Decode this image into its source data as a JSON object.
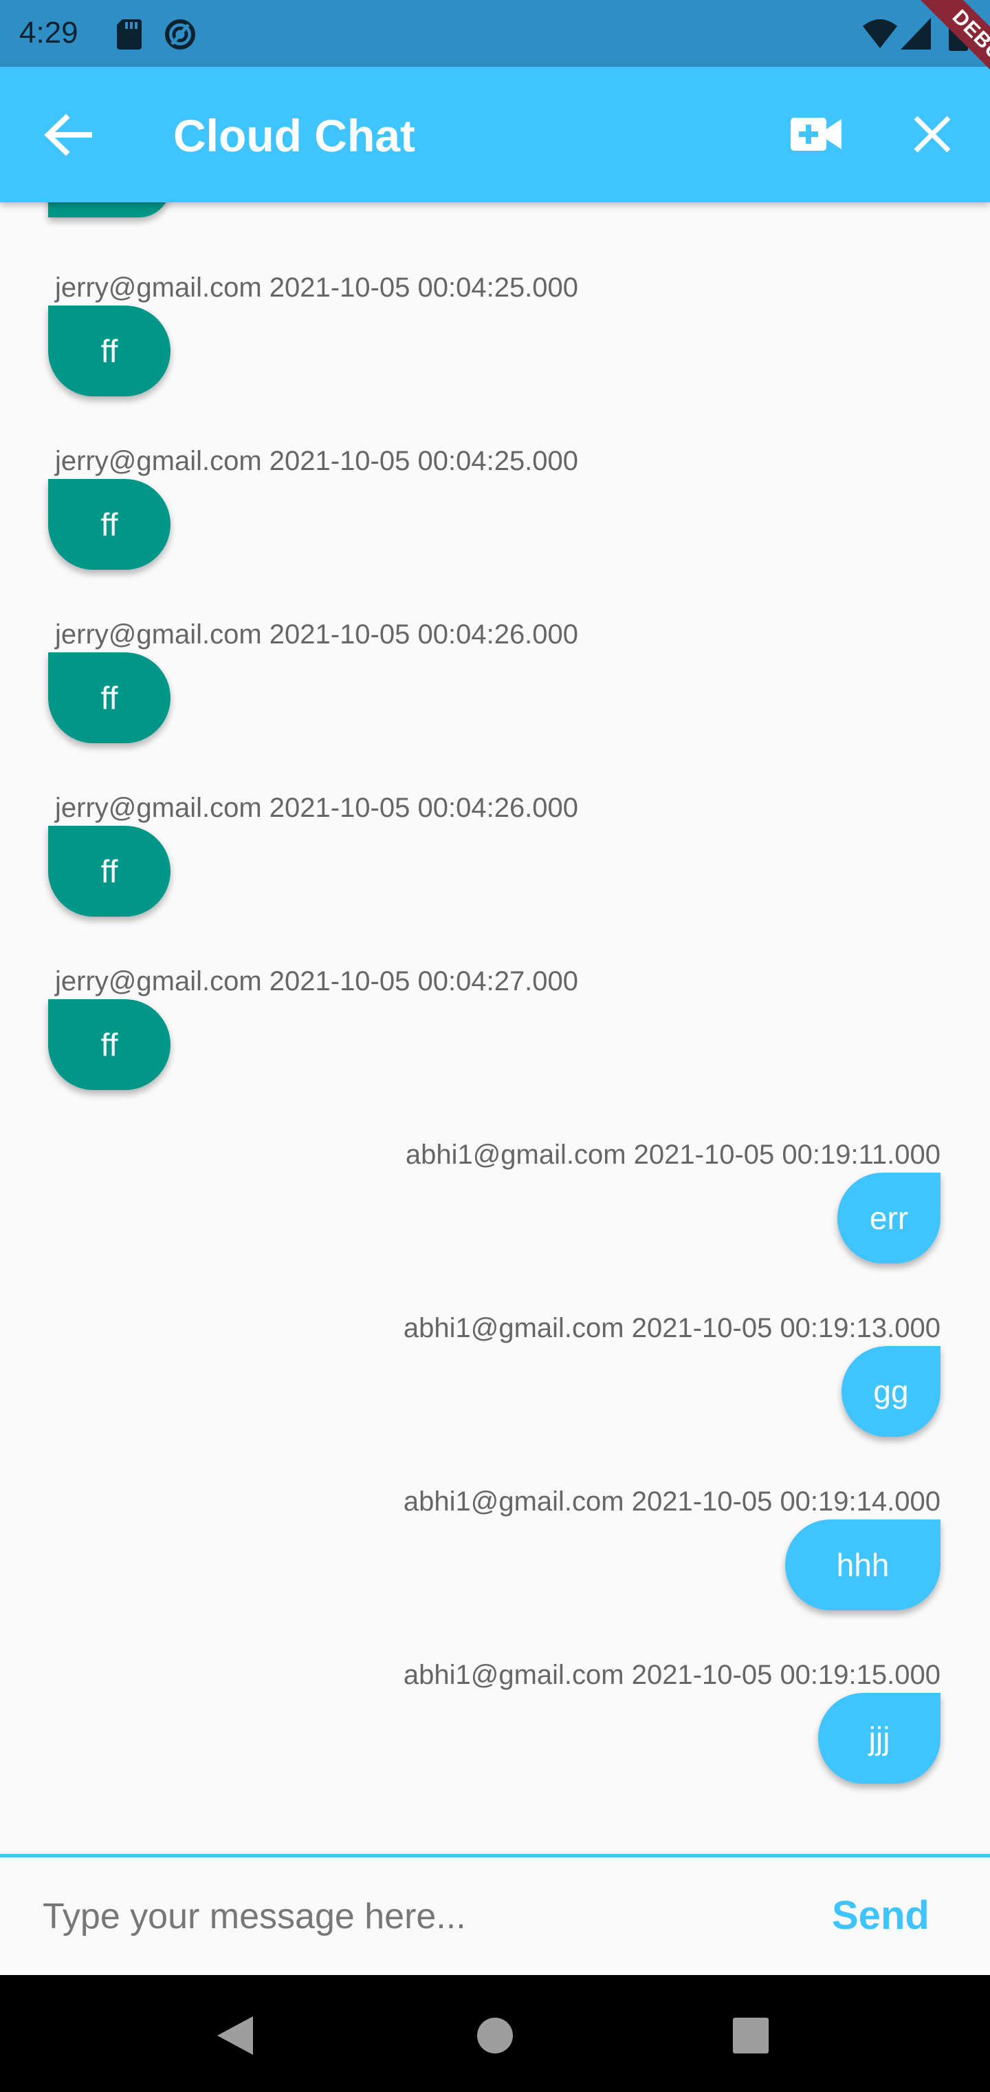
{
  "status_bar": {
    "time": "4:29",
    "icons": [
      "sd-card-icon",
      "sync-icon",
      "wifi-icon",
      "signal-icon",
      "battery-icon"
    ]
  },
  "app_bar": {
    "title": "Cloud Chat",
    "back_icon": "arrow-back-icon",
    "video_icon": "video-call-icon",
    "close_icon": "close-icon",
    "color": "#40c4ff"
  },
  "debug_banner": "DEBUG",
  "messages": [
    {
      "sender": "jerry@gmail.com 2021-10-05 00:04:25.000",
      "text": "ff",
      "direction": "incoming"
    },
    {
      "sender": "jerry@gmail.com 2021-10-05 00:04:25.000",
      "text": "ff",
      "direction": "incoming"
    },
    {
      "sender": "jerry@gmail.com 2021-10-05 00:04:26.000",
      "text": "ff",
      "direction": "incoming"
    },
    {
      "sender": "jerry@gmail.com 2021-10-05 00:04:26.000",
      "text": "ff",
      "direction": "incoming"
    },
    {
      "sender": "jerry@gmail.com 2021-10-05 00:04:27.000",
      "text": "ff",
      "direction": "incoming"
    },
    {
      "sender": "abhi1@gmail.com 2021-10-05 00:19:11.000",
      "text": "err",
      "direction": "outgoing"
    },
    {
      "sender": "abhi1@gmail.com 2021-10-05 00:19:13.000",
      "text": "gg",
      "direction": "outgoing"
    },
    {
      "sender": "abhi1@gmail.com 2021-10-05 00:19:14.000",
      "text": "hhh",
      "direction": "outgoing"
    },
    {
      "sender": "abhi1@gmail.com 2021-10-05 00:19:15.000",
      "text": "jjj",
      "direction": "outgoing"
    }
  ],
  "colors": {
    "incoming_bubble": "#009688",
    "outgoing_bubble": "#40c4ff"
  },
  "composer": {
    "placeholder": "Type your message here...",
    "value": "",
    "send_label": "Send"
  },
  "nav_bar": {
    "icons": [
      "nav-back-icon",
      "nav-home-icon",
      "nav-recents-icon"
    ]
  }
}
